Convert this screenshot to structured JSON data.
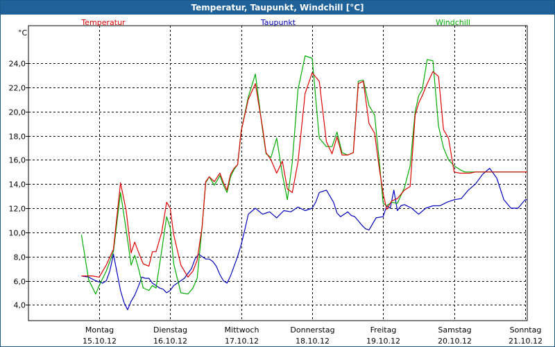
{
  "window": {
    "title": "Temperatur, Taupunkt, Windchill [°C]"
  },
  "colors": {
    "titlebar": "#1f6199",
    "temperature": "#dd0000",
    "dewpoint": "#0000bb",
    "windchill": "#00aa00",
    "grid": "#000000"
  },
  "chart_data": {
    "type": "line",
    "title": "Temperatur, Taupunkt, Windchill [°C]",
    "ylabel": "°C",
    "ylim": [
      2.7,
      27.1
    ],
    "xlim": [
      0,
      7.05
    ],
    "grid": true,
    "legend_position": "top",
    "yticks": [
      4,
      6,
      8,
      10,
      12,
      14,
      16,
      18,
      20,
      22,
      24
    ],
    "ytick_labels": [
      "4,0",
      "6,0",
      "8,0",
      "10,0",
      "12,0",
      "14,0",
      "16,0",
      "18,0",
      "20,0",
      "22,0",
      "24,0"
    ],
    "x_ticks": [
      {
        "x": 0,
        "day": "Montag",
        "date": "15.10.12"
      },
      {
        "x": 1,
        "day": "Dienstag",
        "date": "16.10.12"
      },
      {
        "x": 2,
        "day": "Mittwoch",
        "date": "17.10.12"
      },
      {
        "x": 3,
        "day": "Donnerstag",
        "date": "18.10.12"
      },
      {
        "x": 4,
        "day": "Freitag",
        "date": "19.10.12"
      },
      {
        "x": 5,
        "day": "Samstag",
        "date": "20.10.12"
      },
      {
        "x": 6,
        "day": "Sonntag",
        "date": "21.10.12"
      }
    ],
    "series": [
      {
        "name": "Temperatur",
        "color": "#dd0000",
        "x": [
          -0.25,
          -0.1,
          0,
          0.1,
          0.2,
          0.3,
          0.38,
          0.45,
          0.5,
          0.55,
          0.62,
          0.7,
          0.75,
          0.8,
          0.88,
          0.95,
          1.0,
          1.05,
          1.15,
          1.25,
          1.32,
          1.38,
          1.45,
          1.5,
          1.55,
          1.62,
          1.7,
          1.75,
          1.8,
          1.85,
          1.9,
          1.95,
          2.0,
          2.1,
          2.2,
          2.3,
          2.35,
          2.42,
          2.5,
          2.58,
          2.65,
          2.72,
          2.8,
          2.9,
          3.0,
          3.1,
          3.2,
          3.28,
          3.35,
          3.42,
          3.5,
          3.58,
          3.65,
          3.72,
          3.8,
          3.88,
          3.95,
          4.0,
          4.05,
          4.12,
          4.2,
          4.3,
          4.38,
          4.45,
          4.5,
          4.55,
          4.62,
          4.7,
          4.78,
          4.85,
          4.92,
          5.0,
          5.08,
          5.15,
          5.22,
          5.3,
          5.4,
          5.5,
          5.55,
          5.6,
          5.65,
          5.72,
          5.8,
          5.88,
          5.95,
          6.0,
          6.05,
          6.12,
          6.2,
          6.28,
          6.35,
          6.42,
          6.5,
          6.55,
          6.6,
          6.65,
          6.72,
          6.8,
          6.88,
          6.95,
          7.0
        ],
        "y": [
          6.4,
          6.4,
          6.3,
          7.3,
          8.6,
          14.1,
          11.8,
          8.3,
          9.2,
          8.4,
          7.4,
          7.2,
          8.4,
          8.4,
          10.0,
          12.5,
          12.0,
          9.8,
          7.3,
          6.3,
          6.8,
          7.7,
          10.5,
          14.2,
          14.6,
          14.2,
          14.9,
          14.1,
          13.5,
          14.8,
          15.3,
          15.6,
          18.4,
          21.0,
          22.3,
          18.7,
          16.6,
          16.0,
          14.9,
          15.9,
          13.6,
          13.3,
          15.8,
          21.5,
          23.2,
          22.5,
          17.5,
          16.5,
          17.9,
          16.4,
          16.4,
          16.6,
          22.3,
          22.5,
          19.0,
          18.2,
          15.1,
          13.2,
          11.9,
          12.6,
          12.8,
          13.5,
          13.8,
          19.7,
          20.7,
          21.3,
          22.3,
          23.3,
          22.9,
          18.5,
          17.8,
          15.0,
          14.9,
          14.9,
          14.9,
          15.0,
          15.0,
          15.0,
          15.0,
          15.0,
          15.0,
          15.0,
          15.0,
          15.0,
          15.0,
          15.0,
          15.0,
          15.0,
          15.0,
          15.0,
          15.0,
          15.0,
          15.0,
          15.0,
          15.0,
          15.0,
          15.0,
          15.0,
          15.0,
          15.0,
          15.0
        ]
      },
      {
        "name": "Taupunkt",
        "color": "#0000bb",
        "x": [
          -0.25,
          -0.15,
          -0.05,
          0,
          0.05,
          0.1,
          0.15,
          0.2,
          0.3,
          0.35,
          0.4,
          0.45,
          0.5,
          0.55,
          0.6,
          0.65,
          0.7,
          0.75,
          0.8,
          0.85,
          0.9,
          0.95,
          1.0,
          1.05,
          1.1,
          1.2,
          1.3,
          1.35,
          1.4,
          1.45,
          1.5,
          1.55,
          1.6,
          1.65,
          1.7,
          1.75,
          1.8,
          1.85,
          1.9,
          1.95,
          2.0,
          2.05,
          2.1,
          2.2,
          2.3,
          2.4,
          2.5,
          2.6,
          2.7,
          2.8,
          2.9,
          3.0,
          3.05,
          3.1,
          3.2,
          3.3,
          3.35,
          3.4,
          3.5,
          3.55,
          3.6,
          3.7,
          3.75,
          3.8,
          3.9,
          4.0,
          4.05,
          4.1,
          4.15,
          4.2,
          4.25,
          4.3,
          4.4,
          4.5,
          4.6,
          4.7,
          4.8,
          4.9,
          5.0,
          5.1,
          5.2,
          5.3,
          5.4,
          5.5,
          5.6,
          5.7,
          5.8,
          5.9,
          6.0,
          6.05,
          6.1,
          6.2,
          6.3,
          6.4,
          6.5,
          6.6,
          6.7,
          6.8,
          6.9,
          7.0
        ],
        "y": [
          6.4,
          6.3,
          6.0,
          5.9,
          5.8,
          6.0,
          6.8,
          8.2,
          5.2,
          4.2,
          3.6,
          4.3,
          4.8,
          5.5,
          6.3,
          6.2,
          6.2,
          5.8,
          5.6,
          5.4,
          5.3,
          5.0,
          5.2,
          5.6,
          5.8,
          6.2,
          7.0,
          7.8,
          8.2,
          8.0,
          7.8,
          7.8,
          7.6,
          7.2,
          6.5,
          6.0,
          5.8,
          6.4,
          7.2,
          8.0,
          9.0,
          10.2,
          11.5,
          12.0,
          11.5,
          11.7,
          11.2,
          11.8,
          11.7,
          12.1,
          11.8,
          12.0,
          12.5,
          13.3,
          13.5,
          12.5,
          11.6,
          11.3,
          11.7,
          11.4,
          11.3,
          10.6,
          10.3,
          10.2,
          11.2,
          11.3,
          12.2,
          12.0,
          13.5,
          11.8,
          12.2,
          12.3,
          12.0,
          11.5,
          12.0,
          12.2,
          12.2,
          12.5,
          12.7,
          12.8,
          13.5,
          14.0,
          14.8,
          15.3,
          14.5,
          12.7,
          12.0,
          12.0,
          12.7,
          12.7,
          13.0,
          12.8,
          13.2,
          14.0,
          13.8,
          12.4,
          12.5,
          12.8,
          12.7,
          12.7
        ]
      },
      {
        "name": "Windchill",
        "color": "#00aa00",
        "x": [
          -0.25,
          -0.15,
          -0.05,
          0,
          0.1,
          0.2,
          0.3,
          0.38,
          0.45,
          0.5,
          0.55,
          0.62,
          0.7,
          0.75,
          0.8,
          0.88,
          0.95,
          1.0,
          1.05,
          1.15,
          1.25,
          1.32,
          1.38,
          1.45,
          1.5,
          1.55,
          1.62,
          1.7,
          1.75,
          1.8,
          1.85,
          1.9,
          1.95,
          2.0,
          2.1,
          2.2,
          2.3,
          2.35,
          2.42,
          2.5,
          2.58,
          2.65,
          2.72,
          2.8,
          2.9,
          3.0,
          3.1,
          3.2,
          3.28,
          3.35,
          3.42,
          3.5,
          3.58,
          3.65,
          3.72,
          3.8,
          3.88,
          3.95,
          4.0,
          4.05,
          4.12,
          4.2,
          4.3,
          4.38,
          4.45,
          4.5,
          4.55,
          4.62,
          4.7,
          4.78,
          4.85,
          4.92,
          5.0,
          5.08,
          5.15,
          5.22,
          5.3,
          5.4,
          5.5,
          5.55,
          5.6,
          5.65,
          5.72,
          5.8,
          5.88,
          5.95,
          6.0
        ],
        "y": [
          9.8,
          6.1,
          4.9,
          5.6,
          6.8,
          8.4,
          13.3,
          10.2,
          7.3,
          8.1,
          7.1,
          5.4,
          5.2,
          5.6,
          5.4,
          8.5,
          11.3,
          10.4,
          7.4,
          5.0,
          4.9,
          5.4,
          6.2,
          10.5,
          14.1,
          14.6,
          13.9,
          14.7,
          13.9,
          13.3,
          14.6,
          15.2,
          15.6,
          18.4,
          21.2,
          23.1,
          18.5,
          16.5,
          16.2,
          17.8,
          14.8,
          12.7,
          15.8,
          21.8,
          24.6,
          24.4,
          17.8,
          17.1,
          17.1,
          18.3,
          16.6,
          16.4,
          16.6,
          22.5,
          22.6,
          20.5,
          19.7,
          15.6,
          12.4,
          12.2,
          12.5,
          12.4,
          13.7,
          15.5,
          20.0,
          21.3,
          21.8,
          24.3,
          24.2,
          18.8,
          17.0,
          16.0,
          15.5,
          15.2,
          15.0,
          15.0,
          15.0,
          15.0,
          15.0,
          15.0,
          15.0,
          15.0,
          15.0,
          15.0,
          15.0,
          15.0,
          15.0
        ]
      }
    ]
  }
}
